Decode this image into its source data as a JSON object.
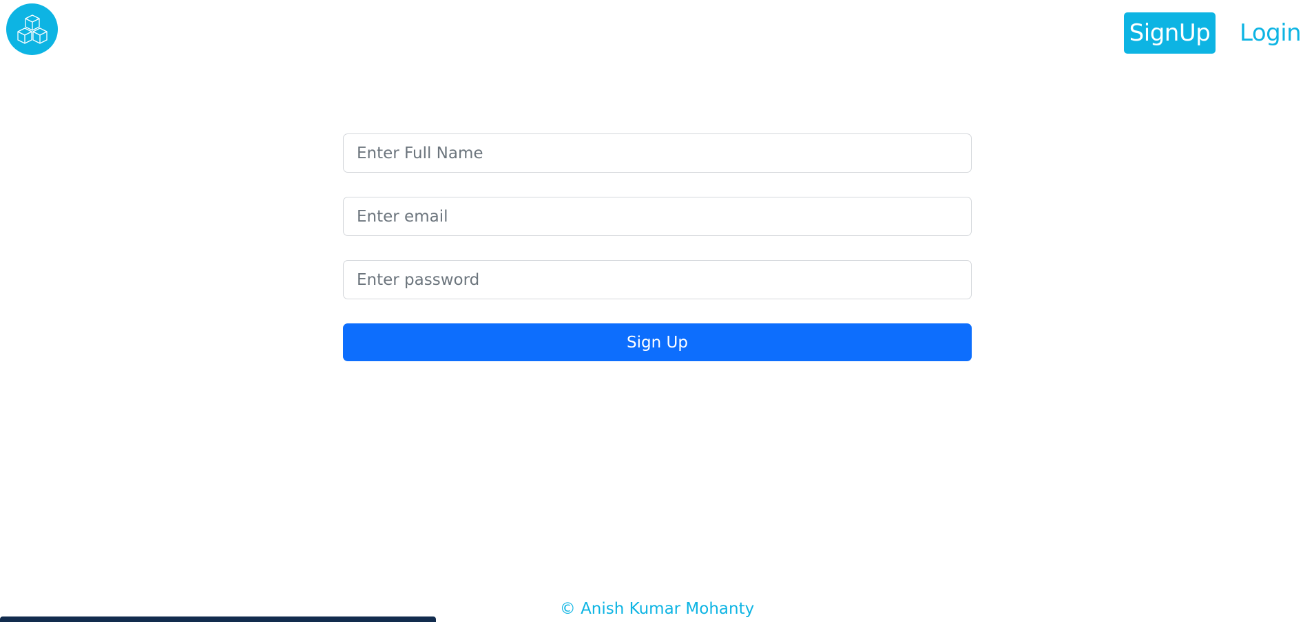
{
  "header": {
    "logo_icon": "boxes-icon",
    "nav": {
      "signup_label": "SignUp",
      "login_label": "Login"
    }
  },
  "form": {
    "full_name": {
      "placeholder": "Enter Full Name",
      "value": ""
    },
    "email": {
      "placeholder": "Enter email",
      "value": ""
    },
    "password": {
      "placeholder": "Enter password",
      "value": ""
    },
    "submit_label": "Sign Up"
  },
  "footer": {
    "copyright": "© Anish Kumar Mohanty"
  },
  "colors": {
    "brand": "#0db4e3",
    "primary": "#0d6efd",
    "bottom_bar": "#122c4e"
  }
}
